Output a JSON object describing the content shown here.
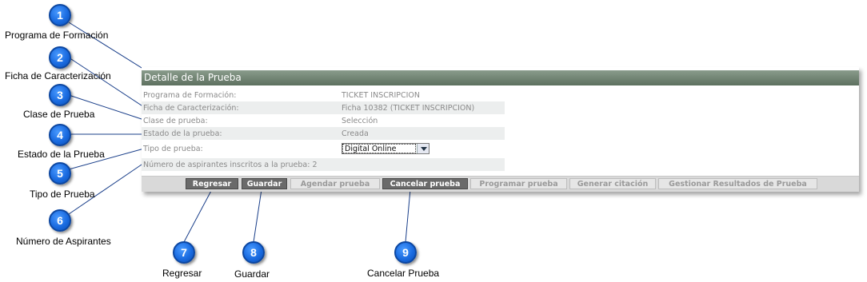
{
  "callouts": [
    {
      "number": "1",
      "label": "Programa de Formación"
    },
    {
      "number": "2",
      "label": "Ficha de Caracterización"
    },
    {
      "number": "3",
      "label": "Clase de Prueba"
    },
    {
      "number": "4",
      "label": "Estado de la Prueba"
    },
    {
      "number": "5",
      "label": "Tipo de Prueba"
    },
    {
      "number": "6",
      "label": "Número de Aspirantes"
    },
    {
      "number": "7",
      "label": "Regresar"
    },
    {
      "number": "8",
      "label": "Guardar"
    },
    {
      "number": "9",
      "label": "Cancelar Prueba"
    }
  ],
  "panel": {
    "title": "Detalle de la Prueba",
    "fields": [
      {
        "label": "Programa de Formación:",
        "value": "TICKET INSCRIPCION"
      },
      {
        "label": "Ficha de Caracterización:",
        "value": "Ficha 10382 (TICKET INSCRIPCION)"
      },
      {
        "label": "Clase de prueba:",
        "value": "Selección"
      },
      {
        "label": "Estado de la prueba:",
        "value": "Creada"
      },
      {
        "label": "Tipo de prueba:",
        "value": "Digital Online"
      },
      {
        "label": "Número de aspirantes inscritos a la prueba: 2",
        "value": ""
      }
    ],
    "buttons": [
      {
        "label": "Regresar",
        "enabled": true
      },
      {
        "label": "Guardar",
        "enabled": true
      },
      {
        "label": "Agendar prueba",
        "enabled": false
      },
      {
        "label": "Cancelar prueba",
        "enabled": true
      },
      {
        "label": "Programar prueba",
        "enabled": false
      },
      {
        "label": "Generar citación",
        "enabled": false
      },
      {
        "label": "Gestionar Resultados de Prueba",
        "enabled": false
      }
    ]
  },
  "colors": {
    "badge": "#1a6be0",
    "header_bar": "#6f826f",
    "enabled_button": "#6a6a6a",
    "disabled_button": "#e6e6e6"
  }
}
